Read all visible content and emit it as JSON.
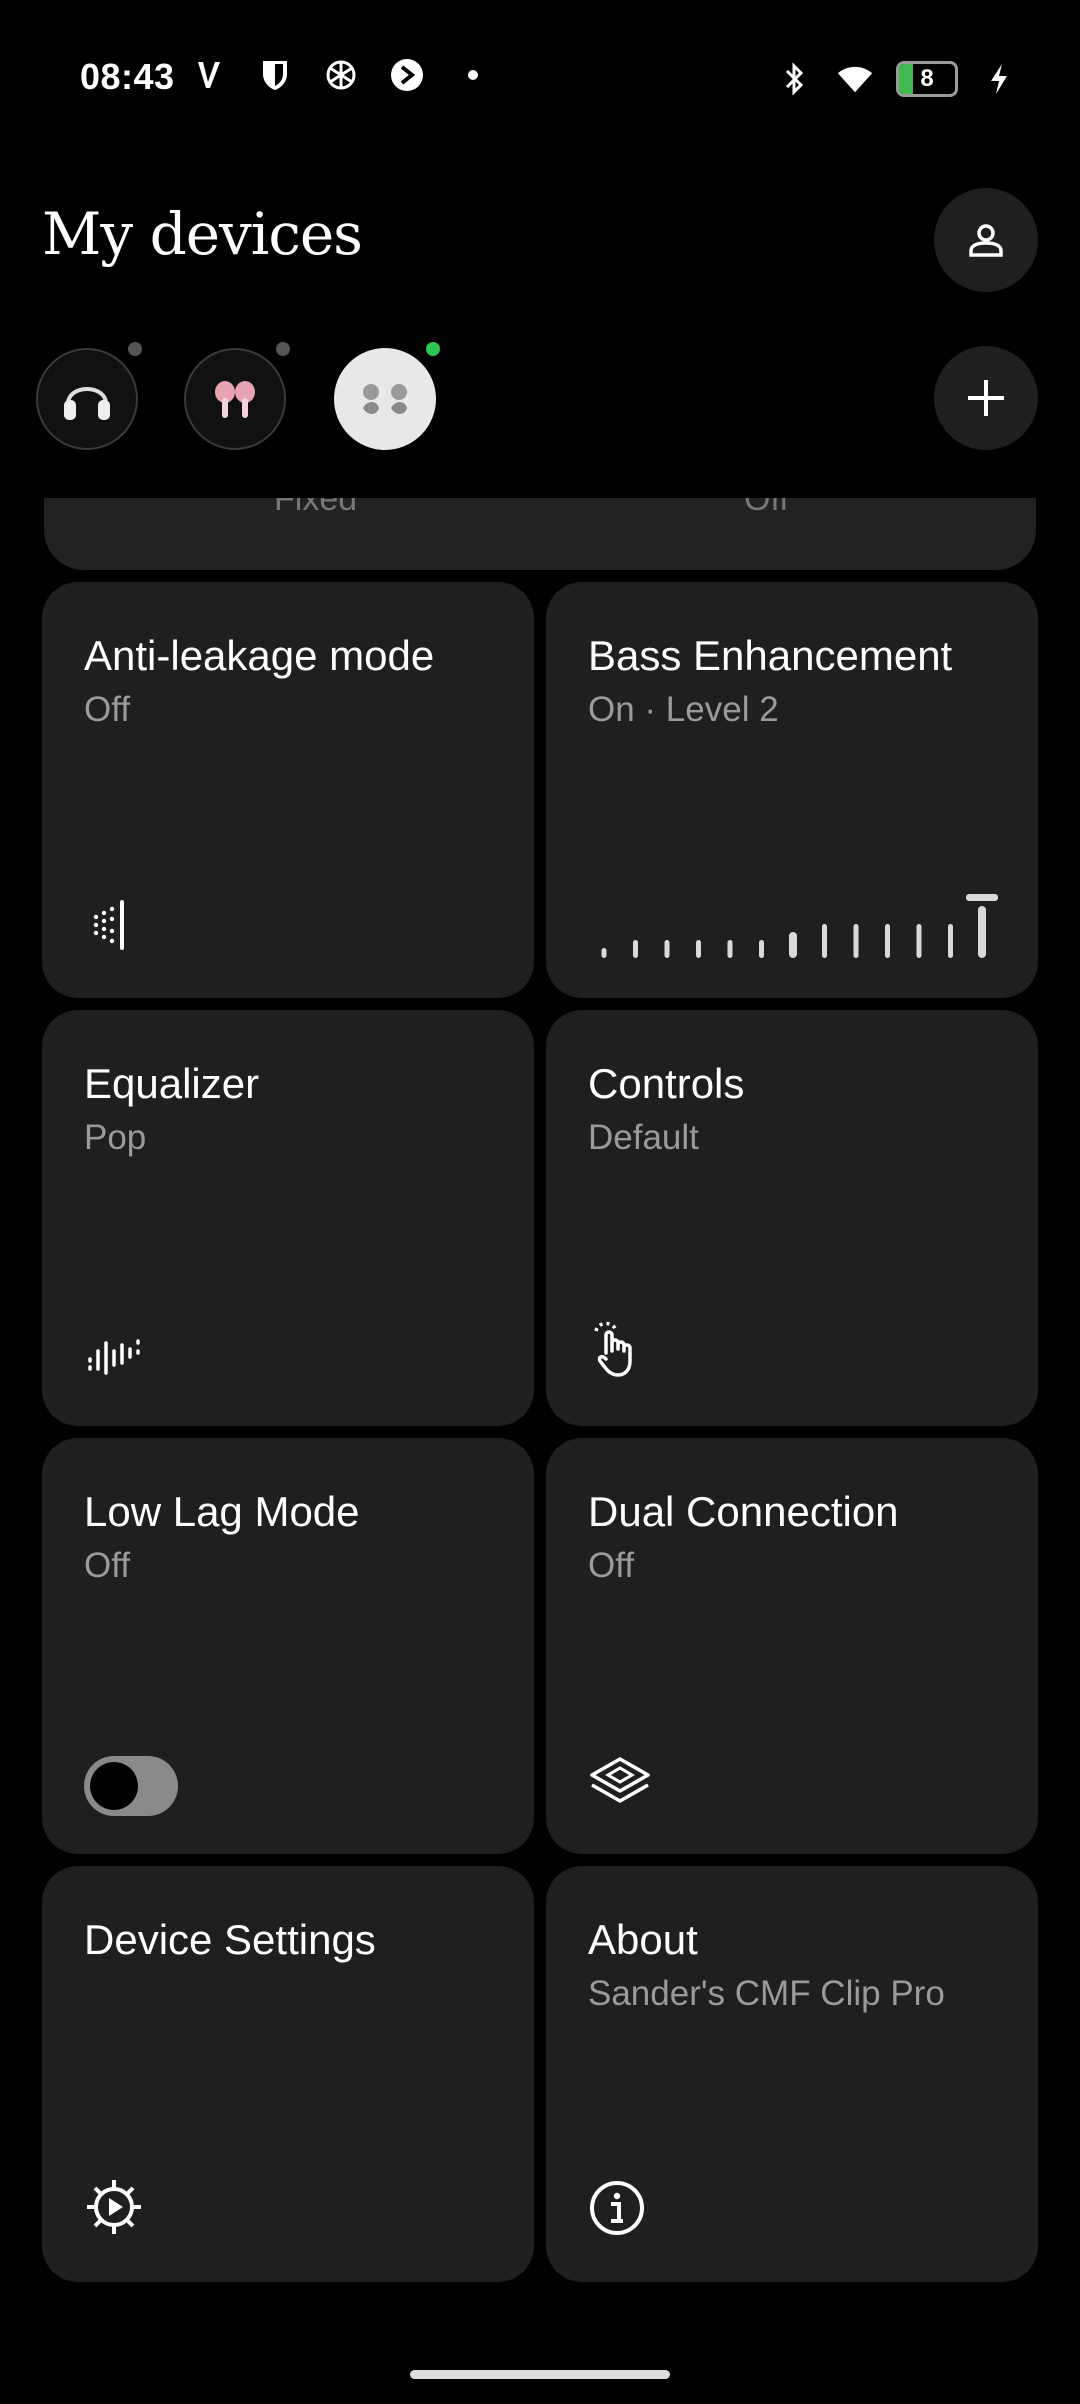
{
  "status": {
    "time": "08:43",
    "battery": "8",
    "battery_level": 0.25
  },
  "header": {
    "title": "My devices"
  },
  "devices": [
    {
      "icon": "over-ear-headphones-icon",
      "connected": false
    },
    {
      "icon": "pink-earbuds-icon",
      "connected": false
    },
    {
      "icon": "clip-earbuds-icon",
      "connected": true,
      "selected": true
    }
  ],
  "partial_card": {
    "left": "Fixed",
    "right": "Off"
  },
  "cards": {
    "anti_leakage": {
      "title": "Anti-leakage mode",
      "value": "Off"
    },
    "bass": {
      "title": "Bass Enhancement",
      "value": "On · Level 2",
      "level": 2
    },
    "equalizer": {
      "title": "Equalizer",
      "value": "Pop"
    },
    "controls": {
      "title": "Controls",
      "value": "Default"
    },
    "low_lag": {
      "title": "Low Lag Mode",
      "value": "Off",
      "enabled": false
    },
    "dual_connection": {
      "title": "Dual Connection",
      "value": "Off"
    },
    "device_settings": {
      "title": "Device Settings"
    },
    "about": {
      "title": "About",
      "value": "Sander's CMF Clip Pro"
    }
  },
  "colors": {
    "background": "#000000",
    "card": "#1f1f1f",
    "muted_text": "#9a9a9a",
    "connected_dot": "#2dc653"
  }
}
